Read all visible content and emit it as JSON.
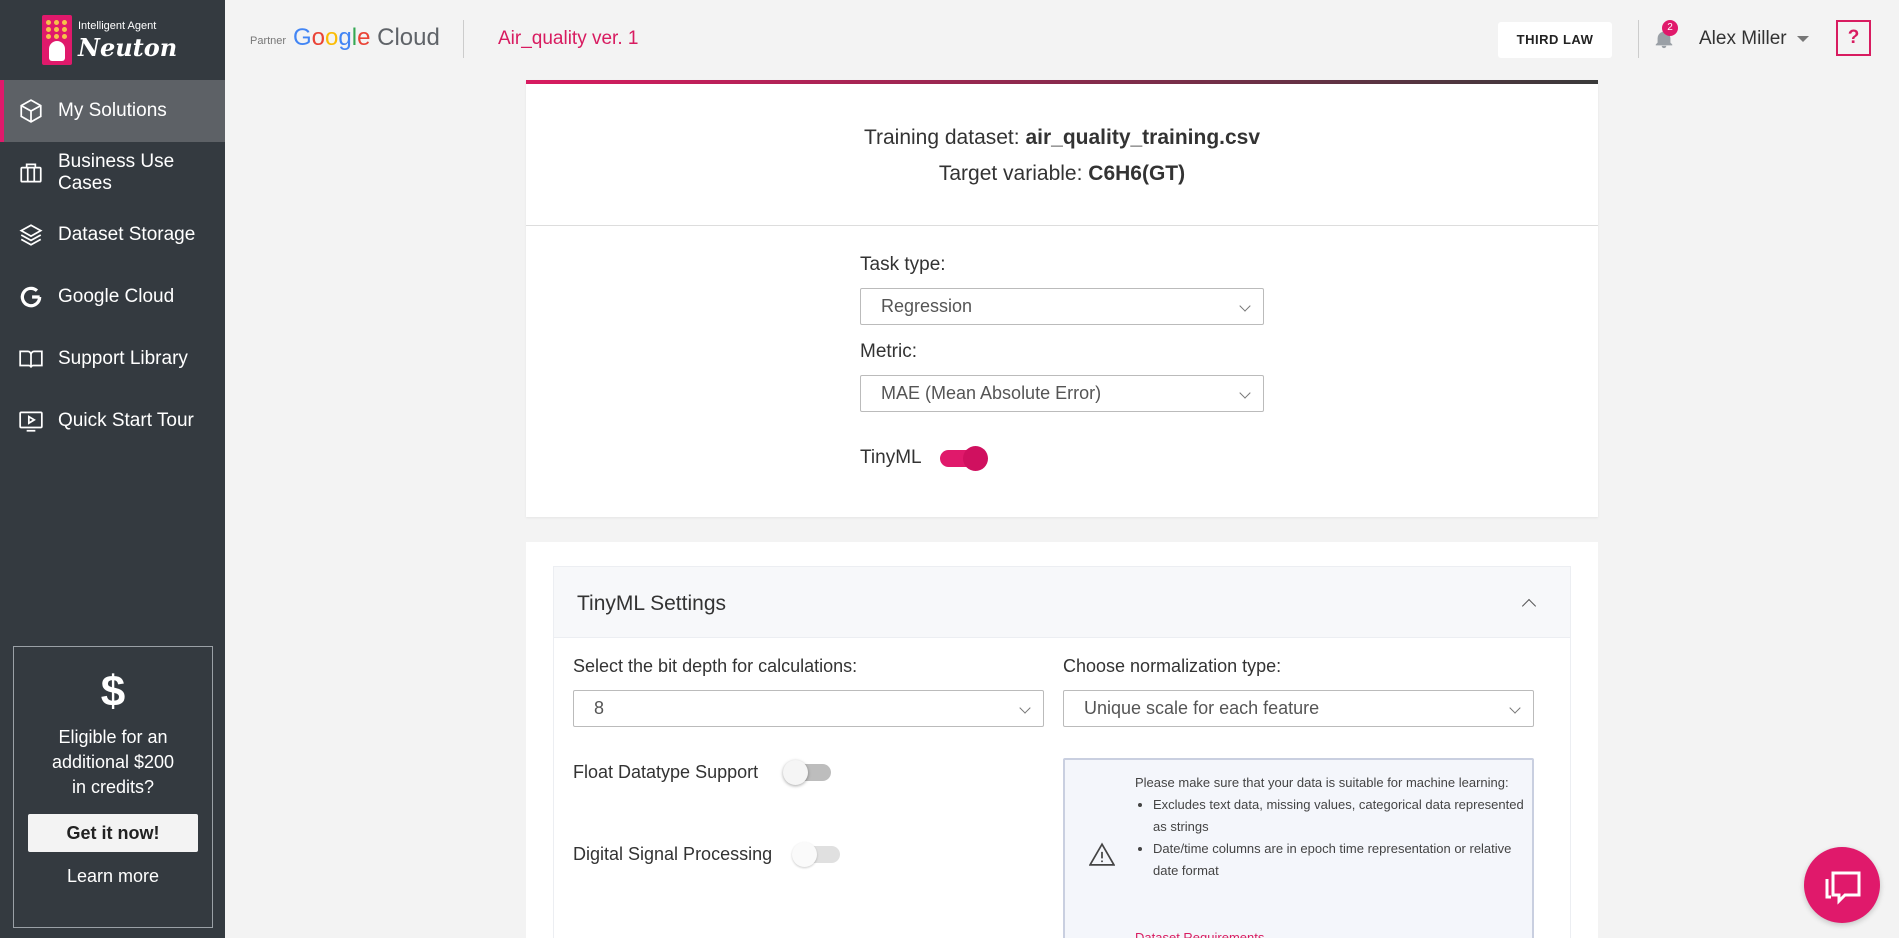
{
  "brand": {
    "small": "Intelligent Agent",
    "name": "Neuton",
    "partner_label": "Partner",
    "google_cloud": [
      "G",
      "o",
      "o",
      "g",
      "l",
      "e"
    ],
    "cloud_word": "Cloud"
  },
  "sidebar": {
    "items": [
      {
        "label": "My Solutions",
        "icon": "cube-icon",
        "active": true
      },
      {
        "label": "Business Use Cases",
        "icon": "briefcase-icon"
      },
      {
        "label": "Dataset Storage",
        "icon": "layers-icon"
      },
      {
        "label": "Google Cloud",
        "icon": "google-g-icon"
      },
      {
        "label": "Support Library",
        "icon": "book-icon"
      },
      {
        "label": "Quick Start Tour",
        "icon": "video-icon"
      }
    ],
    "promo": {
      "symbol": "$",
      "line1": "Eligible for an",
      "line2": "additional $200",
      "line3": "in credits?",
      "button": "Get it now!",
      "link": "Learn more"
    }
  },
  "header": {
    "project": "Air_quality ver. 1",
    "third_law": "THIRD LAW",
    "notifications": "2",
    "user": "Alex Miller",
    "help": "?"
  },
  "summary": {
    "dataset_label": "Training dataset:",
    "dataset_value": "air_quality_training.csv",
    "target_label": "Target variable:",
    "target_value": "C6H6(GT)"
  },
  "form": {
    "task_type_label": "Task type:",
    "task_type_value": "Regression",
    "metric_label": "Metric:",
    "metric_value": "MAE (Mean Absolute Error)",
    "tinyml_label": "TinyML",
    "tinyml_on": true
  },
  "tinyml_settings": {
    "title": "TinyML Settings",
    "bit_depth_label": "Select the bit depth for calculations:",
    "bit_depth_value": "8",
    "normalization_label": "Choose normalization type:",
    "normalization_value": "Unique scale for each feature",
    "float_label": "Float Datatype Support",
    "float_on": false,
    "dsp_label": "Digital Signal Processing",
    "dsp_on": false,
    "warning": {
      "intro": "Please make sure that your data is suitable for machine learning:",
      "bullets": [
        "Excludes text data, missing values, categorical data represented as strings",
        "Date/time columns are in epoch time representation or relative date format"
      ],
      "link": "Dataset Requirements"
    }
  },
  "colors": {
    "accent": "#e0196b",
    "sidebar": "#343a40"
  }
}
